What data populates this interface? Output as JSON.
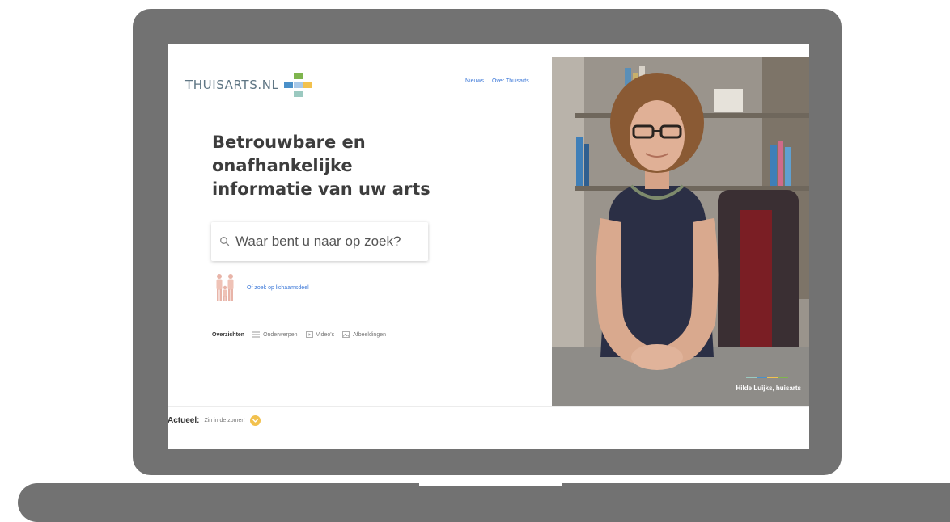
{
  "header": {
    "logo_text": "THUISARTS.NL",
    "nav": [
      {
        "label": "Nieuws"
      },
      {
        "label": "Over Thuisarts"
      }
    ]
  },
  "hero": {
    "headline": "Betrouwbare en onafhankelijke informatie van uw arts",
    "search": {
      "placeholder": "Waar bent u naar op zoek?",
      "value": ""
    },
    "body_search_link": "Of zoek op lichaamsdeel"
  },
  "tabs": [
    {
      "label": "Overzichten",
      "icon": "none",
      "active": true
    },
    {
      "label": "Onderwerpen",
      "icon": "list-icon",
      "active": false
    },
    {
      "label": "Video's",
      "icon": "video-icon",
      "active": false
    },
    {
      "label": "Afbeeldingen",
      "icon": "image-icon",
      "active": false
    }
  ],
  "photo": {
    "caption": "Hilde Luijks, huisarts"
  },
  "actueel": {
    "label": "Actueel:",
    "text": "Zin in de zomer!"
  },
  "colors": {
    "brand_text": "#5f7684",
    "link": "#3c78d8",
    "accent_yellow": "#f2c14e",
    "logo_green": "#7fb54e",
    "logo_blue": "#4a90c9",
    "laptop_gray": "#727272"
  }
}
